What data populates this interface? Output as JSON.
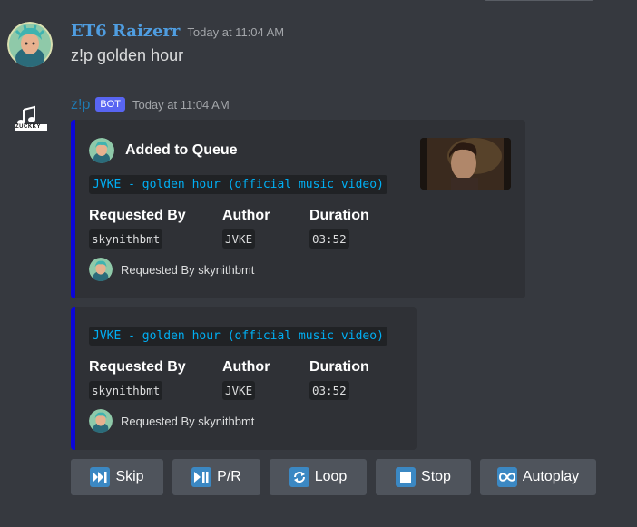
{
  "messages": [
    {
      "username": "ET6 Raizerr",
      "timestamp": "Today at 11:04 AM",
      "content": "z!p golden hour",
      "name_color": "#4f9de0"
    },
    {
      "username": "z!p",
      "bot_badge": "BOT",
      "timestamp": "Today at 11:04 AM",
      "name_color": "#1f7ab3",
      "avatar_label": "ZUCKKY"
    }
  ],
  "embeds": [
    {
      "author": "Added to Queue",
      "title": "JVKE - golden hour (official music video)",
      "fields": [
        {
          "name": "Requested By",
          "value": "skynithbmt"
        },
        {
          "name": "Author",
          "value": "JVKE"
        },
        {
          "name": "Duration",
          "value": "03:52"
        }
      ],
      "footer": "Requested By skynithbmt",
      "border_color": "#0b06d8"
    },
    {
      "title": "JVKE - golden hour (official music video)",
      "fields": [
        {
          "name": "Requested By",
          "value": "skynithbmt"
        },
        {
          "name": "Author",
          "value": "JVKE"
        },
        {
          "name": "Duration",
          "value": "03:52"
        }
      ],
      "footer": "Requested By skynithbmt",
      "border_color": "#0b06d8"
    }
  ],
  "buttons": [
    {
      "label": "Skip",
      "icon": "skip-forward-icon"
    },
    {
      "label": "P/R",
      "icon": "play-pause-icon"
    },
    {
      "label": "Loop",
      "icon": "loop-icon"
    },
    {
      "label": "Stop",
      "icon": "stop-icon"
    },
    {
      "label": "Autoplay",
      "icon": "infinity-icon"
    }
  ],
  "colors": {
    "background": "#36393f",
    "embed_bg": "#2f3136",
    "button_bg": "#4f545c",
    "icon_blue": "#3b88c3",
    "bot_badge": "#5865f2"
  }
}
